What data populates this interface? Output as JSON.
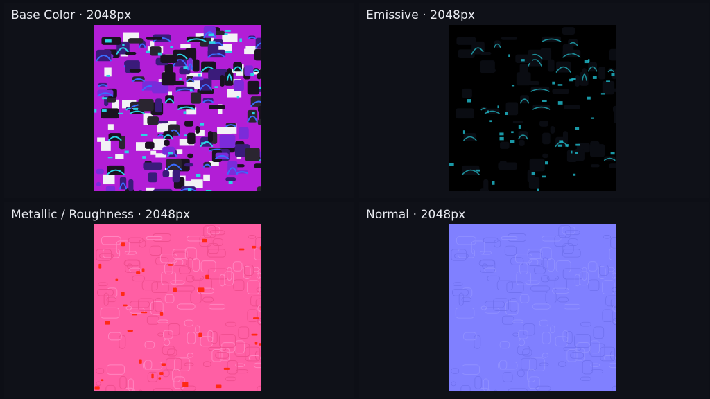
{
  "panels": [
    {
      "label": "Base Color · 2048px",
      "icon": "base-color-texture"
    },
    {
      "label": "Emissive · 2048px",
      "icon": "emissive-texture"
    },
    {
      "label": "Metallic / Roughness · 2048px",
      "icon": "metallic-roughness-texture"
    },
    {
      "label": "Normal · 2048px",
      "icon": "normal-texture"
    }
  ],
  "colors": {
    "background": "#0d0f16",
    "panel": "#0f1118",
    "label": "#e8eaf0",
    "base_magenta": "#b21ed6",
    "base_cyan": "#2bd4e6",
    "emissive_bg": "#000000",
    "metallic_pink": "#ff5fa4",
    "metallic_red": "#ff2a14",
    "normal_blue": "#8080ff"
  }
}
